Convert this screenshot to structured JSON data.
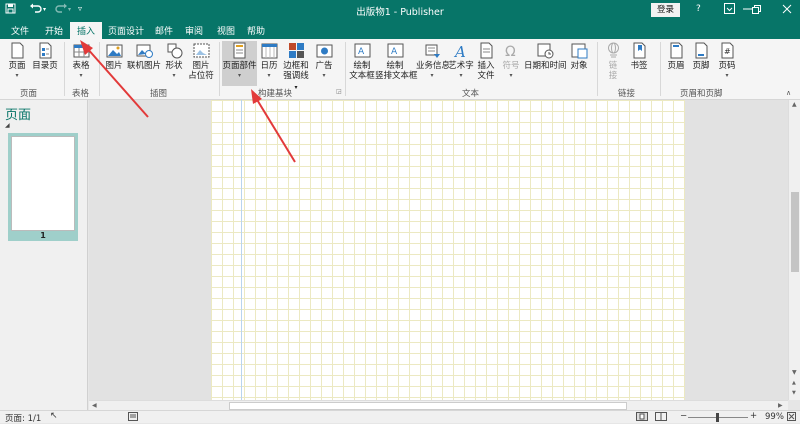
{
  "titlebar": {
    "title": "出版物1 - Publisher",
    "login_label": "登录",
    "help_glyph": "?",
    "icons": [
      "save-icon",
      "undo-icon",
      "redo-icon",
      "customize-qat-icon",
      "ribbon-display-icon",
      "minimize-icon",
      "restore-icon",
      "close-icon"
    ]
  },
  "tabs": [
    "文件",
    "开始",
    "插入",
    "页面设计",
    "邮件",
    "审阅",
    "视图",
    "帮助"
  ],
  "active_tab": "插入",
  "ribbon": {
    "buttons": {
      "page": "页面",
      "catalog_page": "目录页",
      "table": "表格",
      "picture": "图片",
      "online_picture": "联机图片",
      "shapes": "形状",
      "picture_placeholder_1": "图片",
      "picture_placeholder_2": "占位符",
      "page_parts": "页面部件",
      "calendar": "日历",
      "borders_1": "边框和",
      "borders_2": "强调线",
      "ad": "广告",
      "draw_textbox_1": "绘制",
      "draw_textbox_2": "文本框",
      "draw_vtextbox_1": "绘制",
      "draw_vtextbox_2": "竖排文本框",
      "business_info": "业务信息",
      "wordart": "艺术字",
      "insert_file_1": "插入",
      "insert_file_2": "文件",
      "symbol": "符号",
      "datetime": "日期和时间",
      "object": "对象",
      "link_1": "链",
      "link_2": "接",
      "bookmark": "书签",
      "header": "页眉",
      "footer": "页脚",
      "page_number": "页码"
    },
    "groups": {
      "pages": "页面",
      "tables": "表格",
      "illustrations": "插图",
      "building_blocks": "构建基块",
      "text": "文本",
      "links": "链接",
      "header_footer": "页眉和页脚"
    }
  },
  "nav_pane": {
    "title": "页面",
    "page_number": "1"
  },
  "statusbar": {
    "page_info": "页面: 1/1",
    "zoom_percent": "99%",
    "zoom_minus": "−",
    "zoom_plus": "+"
  },
  "colors": {
    "accent": "#077568",
    "annotation_arrow": "#e23a3a",
    "grid": "#ece9c2"
  },
  "annotations": [
    "red-arrow-to-insert-tab",
    "red-arrow-to-page-parts"
  ]
}
